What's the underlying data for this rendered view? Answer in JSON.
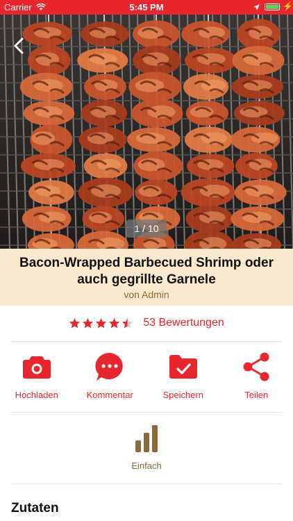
{
  "status_bar": {
    "carrier": "Carrier",
    "time": "5:45 PM"
  },
  "gallery": {
    "counter": "1 / 10"
  },
  "recipe": {
    "title": "Bacon-Wrapped Barbecued Shrimp oder auch gegrillte Garnele",
    "author": "von Admin"
  },
  "rating": {
    "value": 4.5,
    "max": 5,
    "count_label": "53 Bewertungen"
  },
  "actions": [
    {
      "label": "Hochladen",
      "icon": "camera-icon"
    },
    {
      "label": "Kommentar",
      "icon": "comment-icon"
    },
    {
      "label": "Speichern",
      "icon": "folder-check-icon"
    },
    {
      "label": "Teilen",
      "icon": "share-icon"
    }
  ],
  "difficulty": {
    "label": "Einfach",
    "icon": "bar-chart-icon"
  },
  "sections": {
    "ingredients": "Zutaten"
  },
  "colors": {
    "accent": "#e8262d",
    "band": "#fbe9cf",
    "muted": "#8a6a3a"
  }
}
